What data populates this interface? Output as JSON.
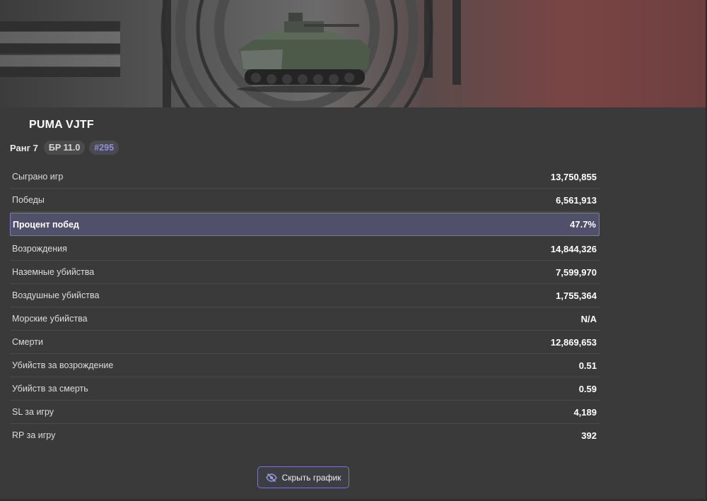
{
  "vehicle": {
    "name": "PUMA VJTF",
    "rank_label": "Ранг 7",
    "br_label": "БР 11.0",
    "position_label": "#295"
  },
  "stats": [
    {
      "label": "Сыграно игр",
      "value": "13,750,855"
    },
    {
      "label": "Победы",
      "value": "6,561,913"
    },
    {
      "label": "Процент побед",
      "value": "47.7%"
    },
    {
      "label": "Возрождения",
      "value": "14,844,326"
    },
    {
      "label": "Наземные убийства",
      "value": "7,599,970"
    },
    {
      "label": "Воздушные убийства",
      "value": "1,755,364"
    },
    {
      "label": "Морские убийства",
      "value": "N/A"
    },
    {
      "label": "Смерти",
      "value": "12,869,653"
    },
    {
      "label": "Убийств за возрождение",
      "value": "0.51"
    },
    {
      "label": "Убийств за смерть",
      "value": "0.59"
    },
    {
      "label": "SL за игру",
      "value": "4,189"
    },
    {
      "label": "RP за игру",
      "value": "392"
    }
  ],
  "actions": {
    "hide_chart_label": "Скрыть график",
    "hide_chart_icon": "eye-slash-icon"
  },
  "colors": {
    "background": "#3a3a3a",
    "highlight_row": "#50506a",
    "accent_border": "#7a7ab8",
    "position_badge_text": "#8f8fd8"
  }
}
